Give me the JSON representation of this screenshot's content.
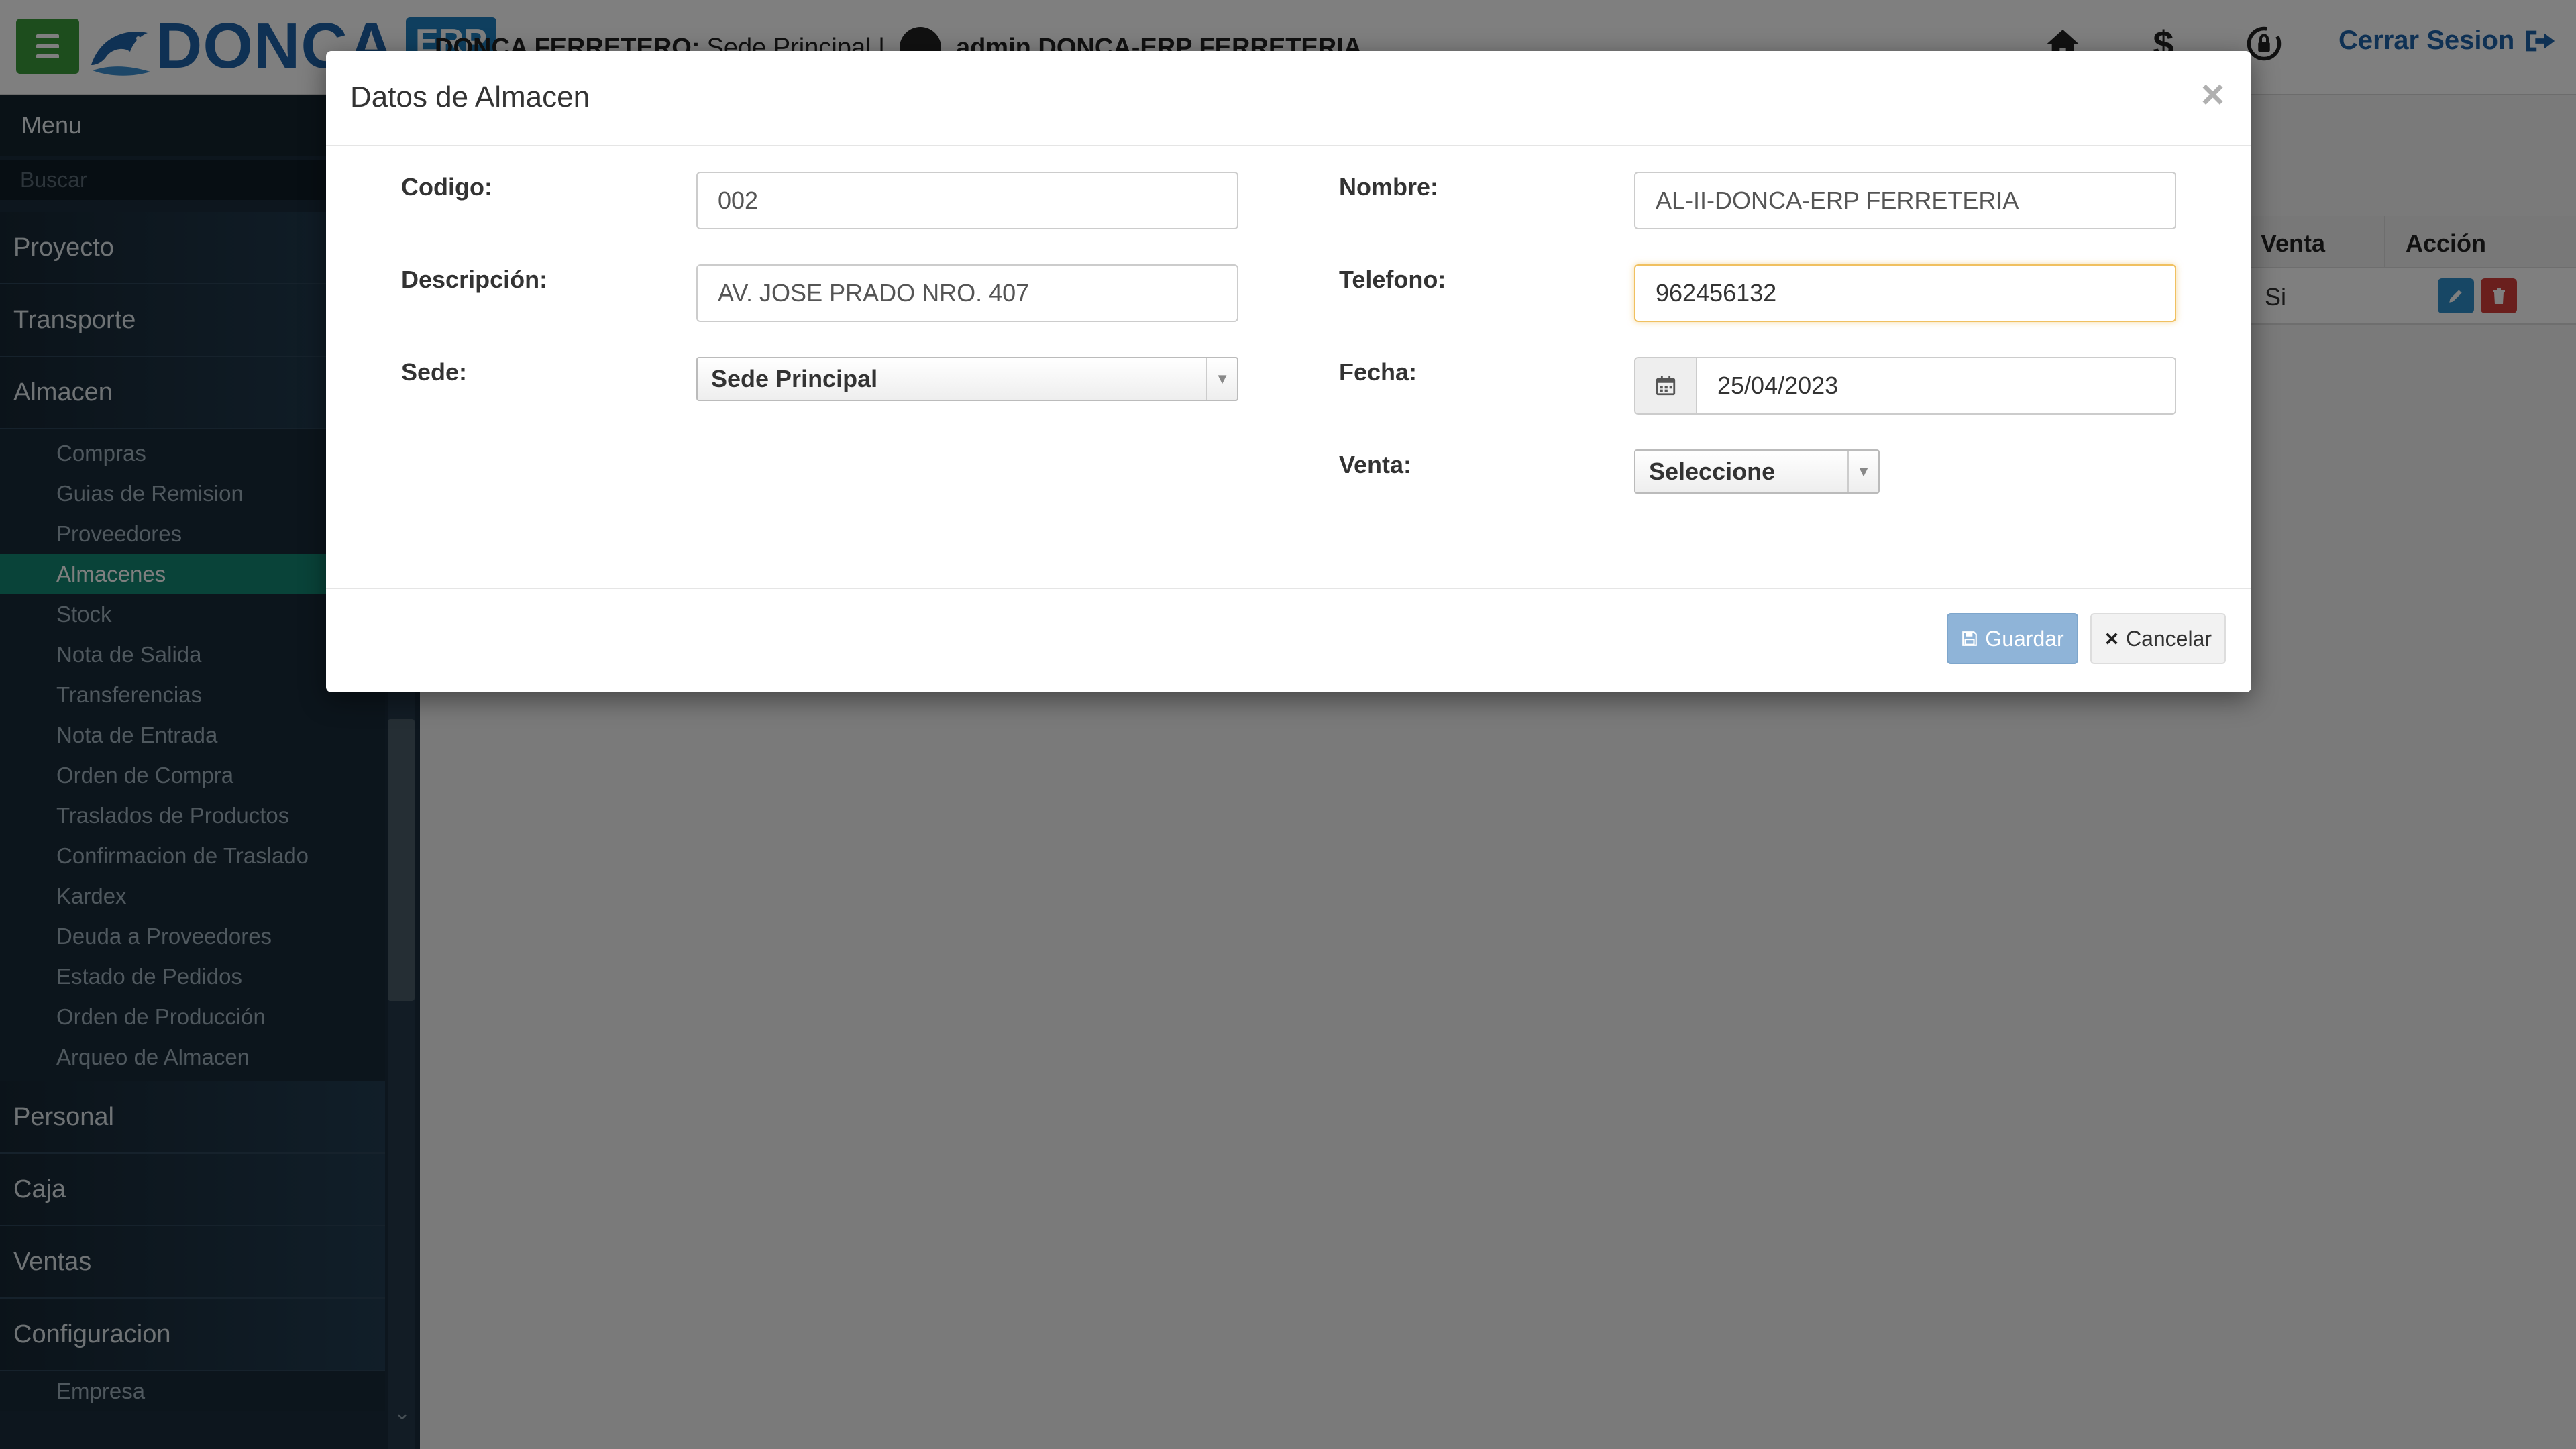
{
  "header": {
    "logo_text": "DONCA",
    "logo_badge": "ERP",
    "company": "DONCA FERRETERO:",
    "sede": "Sede Principal |",
    "user": "admin DONCA-ERP FERRETERIA",
    "logout_label": "Cerrar Sesion"
  },
  "sidebar": {
    "title": "Menu",
    "search_placeholder": "Buscar",
    "sections": {
      "proyecto": "Proyecto",
      "transporte": "Transporte",
      "almacen": "Almacen",
      "personal": "Personal",
      "caja": "Caja",
      "ventas": "Ventas",
      "configuracion": "Configuracion"
    },
    "almacen_items": [
      "Compras",
      "Guias de Remision",
      "Proveedores",
      "Almacenes",
      "Stock",
      "Nota de Salida",
      "Transferencias",
      "Nota de Entrada",
      "Orden de Compra",
      "Traslados de Productos",
      "Confirmacion de Traslado",
      "Kardex",
      "Deuda a Proveedores",
      "Estado de Pedidos",
      "Orden de Producción",
      "Arqueo de Almacen"
    ],
    "config_items": [
      "Empresa"
    ]
  },
  "table": {
    "col_venta": "Venta",
    "col_accion": "Acción",
    "row_venta": "Si"
  },
  "modal": {
    "title": "Datos de Almacen",
    "close": "×",
    "codigo_label": "Codigo:",
    "codigo_value": "002",
    "nombre_label": "Nombre:",
    "nombre_value": "AL-II-DONCA-ERP FERRETERIA",
    "descripcion_label": "Descripción:",
    "descripcion_value": "AV. JOSE PRADO NRO. 407",
    "telefono_label": "Telefono:",
    "telefono_value": "962456132",
    "sede_label": "Sede:",
    "sede_value": "Sede Principal",
    "fecha_label": "Fecha:",
    "fecha_value": "25/04/2023",
    "venta_label": "Venta:",
    "venta_value": "Seleccione",
    "save_label": "Guardar",
    "cancel_label": "Cancelar"
  },
  "colors": {
    "accent_green": "#128672",
    "brand_blue": "#1f63a8",
    "sidebar_bg": "#1a2d3c"
  }
}
